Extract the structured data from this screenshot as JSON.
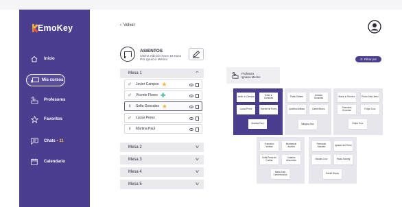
{
  "app": {
    "name": "EmoKey"
  },
  "colors": {
    "brand": "#4b3e8f",
    "star": "#f4b83a",
    "cross": "#3bb3a0"
  },
  "sidebar": {
    "items": [
      {
        "label": "Inicio",
        "icon": "home-icon"
      },
      {
        "label": "Mis cursos",
        "icon": "classroom-icon",
        "active": true
      },
      {
        "label": "Profesores",
        "icon": "teacher-icon"
      },
      {
        "label": "Favoritos",
        "icon": "star-icon"
      },
      {
        "label": "Chats",
        "badge": "• 11",
        "icon": "chat-icon"
      },
      {
        "label": "Calendario",
        "icon": "calendar-icon"
      }
    ]
  },
  "header": {
    "back_label": "Volver"
  },
  "course": {
    "title": "ASIENTOS",
    "line1": "Última edición hace 18 mins",
    "line2": "Por Ignacio Merino"
  },
  "filter_label": "Filtrar por",
  "mesas": [
    {
      "name": "Mesa 1",
      "expanded": true,
      "students": [
        {
          "name": "Javier Campos",
          "gender": "male",
          "marker": "star"
        },
        {
          "name": "Vicente Flores",
          "gender": "male",
          "marker": "cross"
        },
        {
          "name": "Sofia Gonzales",
          "gender": "female",
          "marker": "star",
          "selected": true
        },
        {
          "name": "Lucas Perez",
          "gender": "male",
          "marker": ""
        },
        {
          "name": "Martina Paul",
          "gender": "female",
          "marker": ""
        }
      ]
    },
    {
      "name": "Mesa 2",
      "expanded": false
    },
    {
      "name": "Mesa 3",
      "expanded": false
    },
    {
      "name": "Mesa 4",
      "expanded": false
    },
    {
      "name": "Mesa 5",
      "expanded": false
    }
  ],
  "seating": {
    "teacher": {
      "label": "Profesora",
      "name": "Ignacia Merino"
    },
    "groups": [
      {
        "seats": [
          "Javier ★ Campos",
          "Sofia ★ Gonzales",
          "Lucas Perez",
          "Vicente ✚ Flores",
          "Martina Paul"
        ]
      },
      {
        "seats": [
          "Pablo Dalano",
          "Antonia Gonzalez",
          "Josefina Anffass",
          "Daniel Bravo",
          "Milagros Hsu"
        ]
      },
      {
        "seats": [
          "Maria ★ Romero",
          "Pedro Sota Jerez",
          "Francisca Gonzalez",
          "Felipe Cruz",
          "Felipe Cruz"
        ]
      },
      {
        "seats": [
          "Francisco Vedesz",
          "Montserrat Andrea",
          "Sofia Perez de Cuellar",
          "Catalina Almunetes",
          "Maria Jose Cenberbrooks"
        ]
      },
      {
        "seats": [
          "Fernando Morales",
          "Ignacio del Fierro",
          "Nicolas Cruz",
          "Paola Solveig",
          "Daniel Reyes"
        ]
      }
    ]
  }
}
